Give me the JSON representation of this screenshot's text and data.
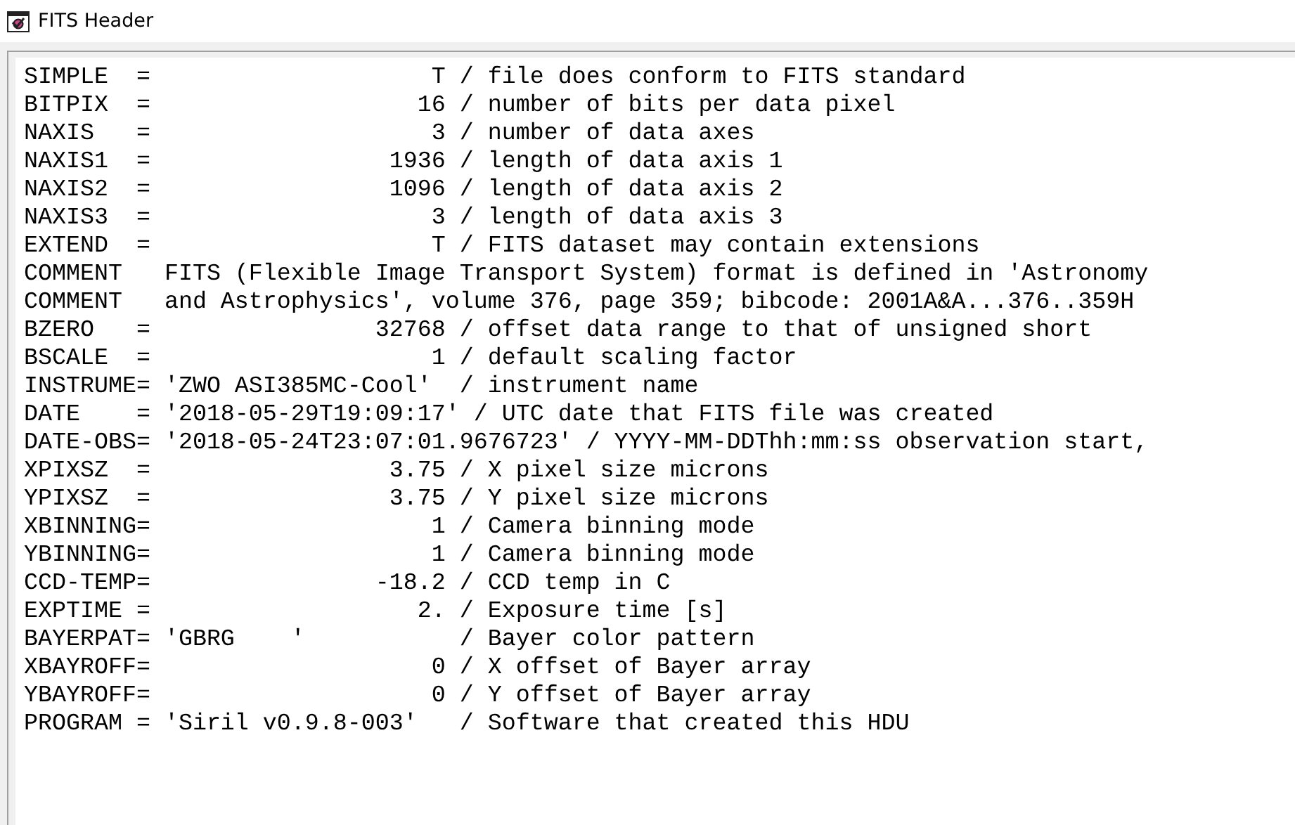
{
  "window": {
    "title": "FITS Header"
  },
  "header_lines": [
    "SIMPLE  =                    T / file does conform to FITS standard",
    "BITPIX  =                   16 / number of bits per data pixel",
    "NAXIS   =                    3 / number of data axes",
    "NAXIS1  =                 1936 / length of data axis 1",
    "NAXIS2  =                 1096 / length of data axis 2",
    "NAXIS3  =                    3 / length of data axis 3",
    "EXTEND  =                    T / FITS dataset may contain extensions",
    "COMMENT   FITS (Flexible Image Transport System) format is defined in 'Astronomy",
    "COMMENT   and Astrophysics', volume 376, page 359; bibcode: 2001A&A...376..359H",
    "BZERO   =                32768 / offset data range to that of unsigned short",
    "BSCALE  =                    1 / default scaling factor",
    "INSTRUME= 'ZWO ASI385MC-Cool'  / instrument name",
    "DATE    = '2018-05-29T19:09:17' / UTC date that FITS file was created",
    "DATE-OBS= '2018-05-24T23:07:01.9676723' / YYYY-MM-DDThh:mm:ss observation start,",
    "XPIXSZ  =                 3.75 / X pixel size microns",
    "YPIXSZ  =                 3.75 / Y pixel size microns",
    "XBINNING=                    1 / Camera binning mode",
    "YBINNING=                    1 / Camera binning mode",
    "CCD-TEMP=                -18.2 / CCD temp in C",
    "EXPTIME =                   2. / Exposure time [s]",
    "BAYERPAT= 'GBRG    '           / Bayer color pattern",
    "XBAYROFF=                    0 / X offset of Bayer array",
    "YBAYROFF=                    0 / Y offset of Bayer array",
    "PROGRAM = 'Siril v0.9.8-003'   / Software that created this HDU"
  ]
}
